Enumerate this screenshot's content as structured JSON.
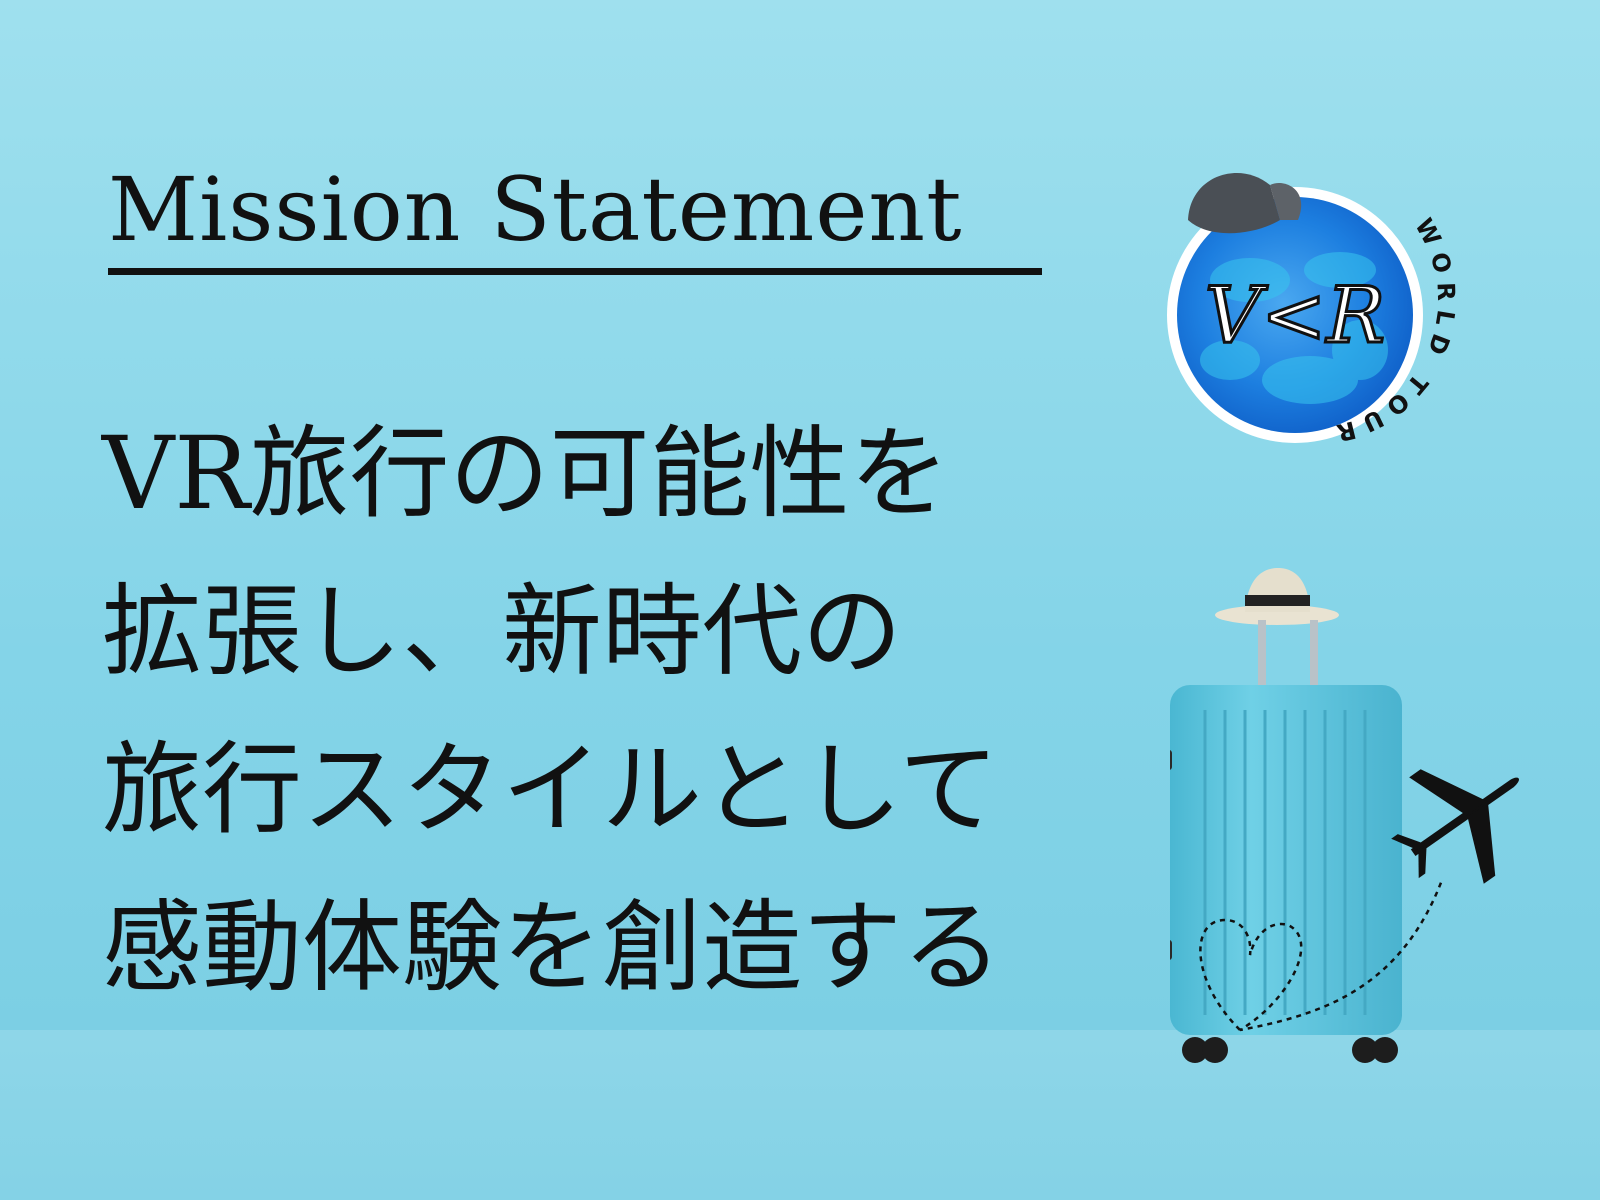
{
  "title": "Mission Statement",
  "statement_lines": [
    "VR旅行の可能性を",
    "拡張し、新時代の",
    "旅行スタイルとして",
    "感動体験を創造する"
  ],
  "logo": {
    "monogram": "V<R",
    "ring_text": "WORLD TOUR"
  },
  "colors": {
    "background": "#9fe0ee",
    "text": "#111111",
    "suitcase": "#5cc3dc",
    "logo_blue": "#1d7fe0"
  },
  "icons": [
    "hat-icon",
    "suitcase-icon",
    "airplane-icon",
    "heart-icon"
  ]
}
